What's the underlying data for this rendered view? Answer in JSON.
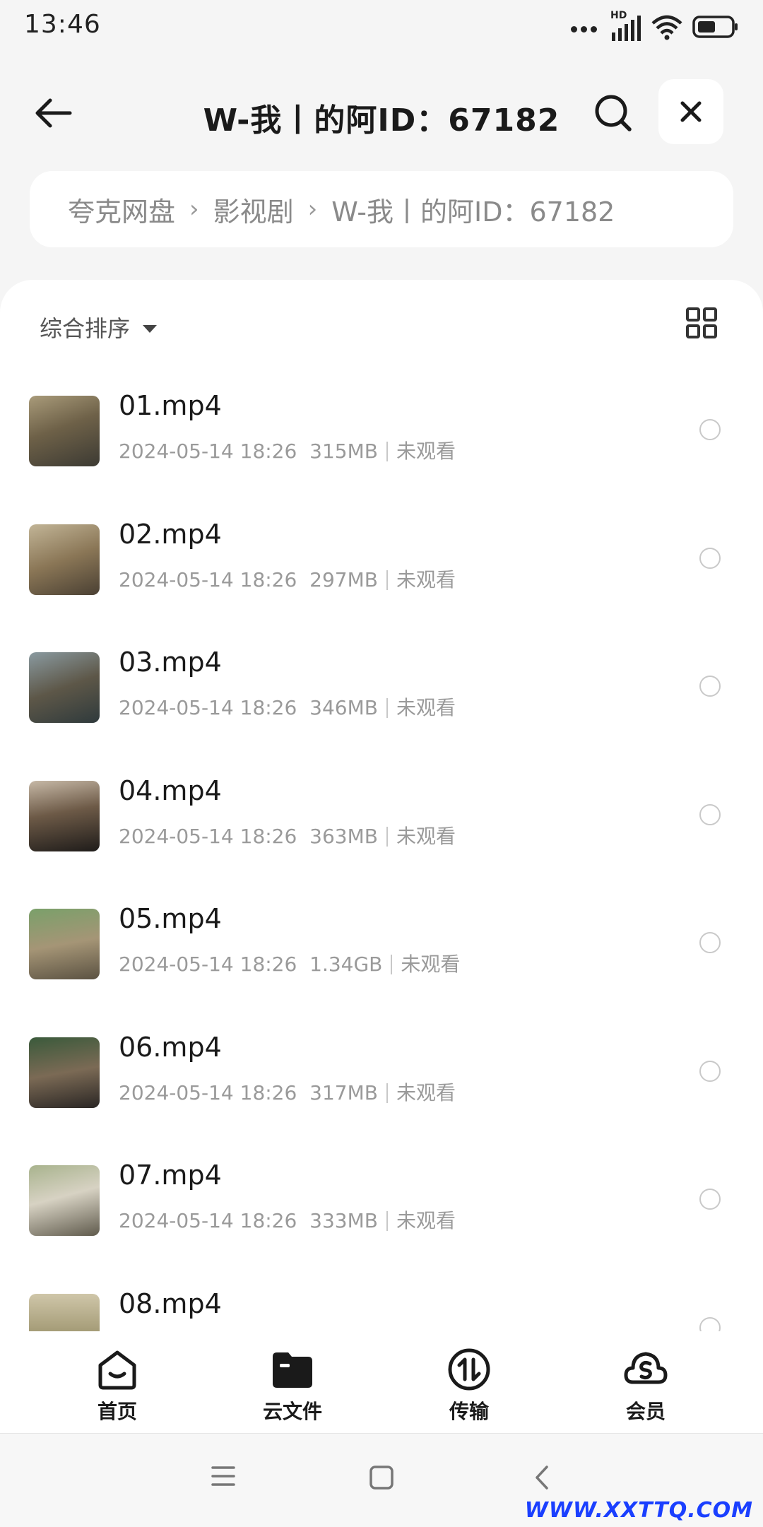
{
  "status_bar": {
    "time": "13:46",
    "network_label": "HD"
  },
  "header": {
    "title": "W-我丨的阿ID：67182"
  },
  "breadcrumb": {
    "items": [
      "夸克网盘",
      "影视剧",
      "W-我丨的阿ID：67182"
    ]
  },
  "sort": {
    "label": "综合排序"
  },
  "files": [
    {
      "name": "01.mp4",
      "date": "2024-05-14 18:26",
      "size": "315MB",
      "status": "未观看"
    },
    {
      "name": "02.mp4",
      "date": "2024-05-14 18:26",
      "size": "297MB",
      "status": "未观看"
    },
    {
      "name": "03.mp4",
      "date": "2024-05-14 18:26",
      "size": "346MB",
      "status": "未观看"
    },
    {
      "name": "04.mp4",
      "date": "2024-05-14 18:26",
      "size": "363MB",
      "status": "未观看"
    },
    {
      "name": "05.mp4",
      "date": "2024-05-14 18:26",
      "size": "1.34GB",
      "status": "未观看"
    },
    {
      "name": "06.mp4",
      "date": "2024-05-14 18:26",
      "size": "317MB",
      "status": "未观看"
    },
    {
      "name": "07.mp4",
      "date": "2024-05-14 18:26",
      "size": "333MB",
      "status": "未观看"
    },
    {
      "name": "08.mp4",
      "date": "",
      "size": "",
      "status": ""
    }
  ],
  "tabs": [
    {
      "label": "首页",
      "icon": "home-icon"
    },
    {
      "label": "云文件",
      "icon": "folder-icon"
    },
    {
      "label": "传输",
      "icon": "transfer-icon"
    },
    {
      "label": "会员",
      "icon": "vip-icon"
    }
  ],
  "watermark": "WWW.XXTTQ.COM",
  "colors": {
    "accent": "#0a5cf5",
    "background": "#f5f5f5",
    "watermark": "#1a3fff"
  }
}
